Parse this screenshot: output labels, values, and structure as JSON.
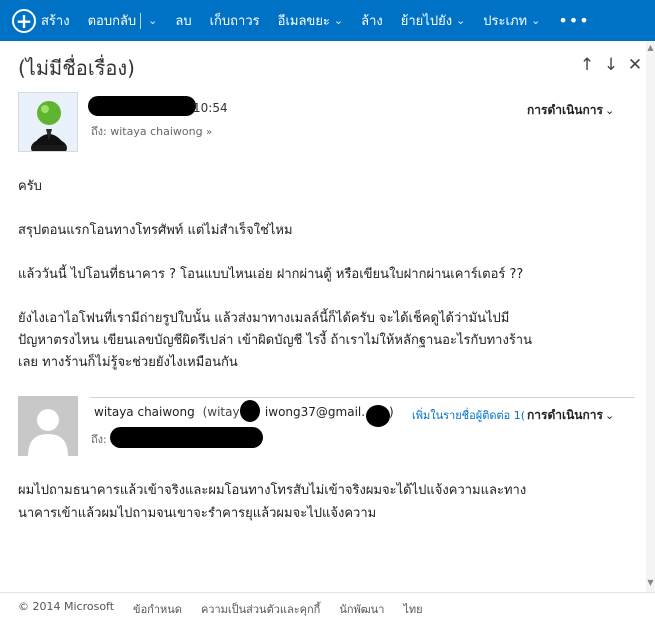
{
  "toolbar": {
    "new_label": "สร้าง",
    "reply_label": "ตอบกลับ",
    "delete_label": "ลบ",
    "archive_label": "เก็บถาวร",
    "junk_label": "อีเมลขยะ",
    "sweep_label": "ล้าง",
    "move_label": "ย้ายไปยัง",
    "category_label": "ประเภท",
    "more_label": "•••"
  },
  "subject": "(ไม่มีชื่อเรื่อง)",
  "message1": {
    "time": "10:54",
    "to_label": "ถึง:",
    "to_name": "witaya chaiwong",
    "actions_label": "การดำเนินการ",
    "lines": [
      "ครับ",
      "",
      "สรุปตอนแรกโอนทางโทรศัพท์ แต่ไม่สำเร็จใช่ไหม",
      "",
      "แล้ววันนี้ ไปโอนที่ธนาคาร ? โอนแบบไหนเอ่ย ฝากผ่านตู้ หรือเขียนใบฝากผ่านเคาร์เตอร์ ??",
      "",
      "ยังไงเอาไอโฟนที่เรามีถ่ายรูปใบนั้น แล้วส่งมาทางเมลล์นี้ก็ได้ครับ จะได้เช็คดูได้ว่ามันไปมี",
      "ปัญหาตรงไหน เขียนเลขบัญชีผิดรึเปล่า เข้าผิดบัญชี ไรงี้ ถ้าเราไม่ให้หลักฐานอะไรกับทางร้าน",
      "เลย ทางร้านก็ไม่รู้จะช่วยยังไงเหมือนกัน"
    ]
  },
  "message2": {
    "sender": "witaya chaiwong",
    "email_prefix": "(witaya",
    "email_middle": "iwong37@gmail.",
    "email_suffix": ")",
    "add_contact": "เพิ่มในรายชื่อผู้ติดต่อ 1(",
    "actions_label": "การดำเนินการ",
    "to_label": "ถึง:",
    "lines": [
      "ผมไปถามธนาคารแล้วเข้าจริงและผมโอนทางโทรสับไม่เข้าจริงผมจะได้ไปแจ้งความและทาง",
      "นาคารเข้าแล้วผมไปถามจนเขาจะรำคารยุแล้วผมจะไปแจ้งความ"
    ]
  },
  "footer": {
    "copyright": "© 2014 Microsoft",
    "terms": "ข้อกำหนด",
    "privacy": "ความเป็นส่วนตัวและคุกกี้",
    "developers": "นักพัฒนา",
    "language": "ไทย"
  },
  "colors": {
    "toolbar_bg": "#0072c6",
    "link": "#0072c6"
  }
}
